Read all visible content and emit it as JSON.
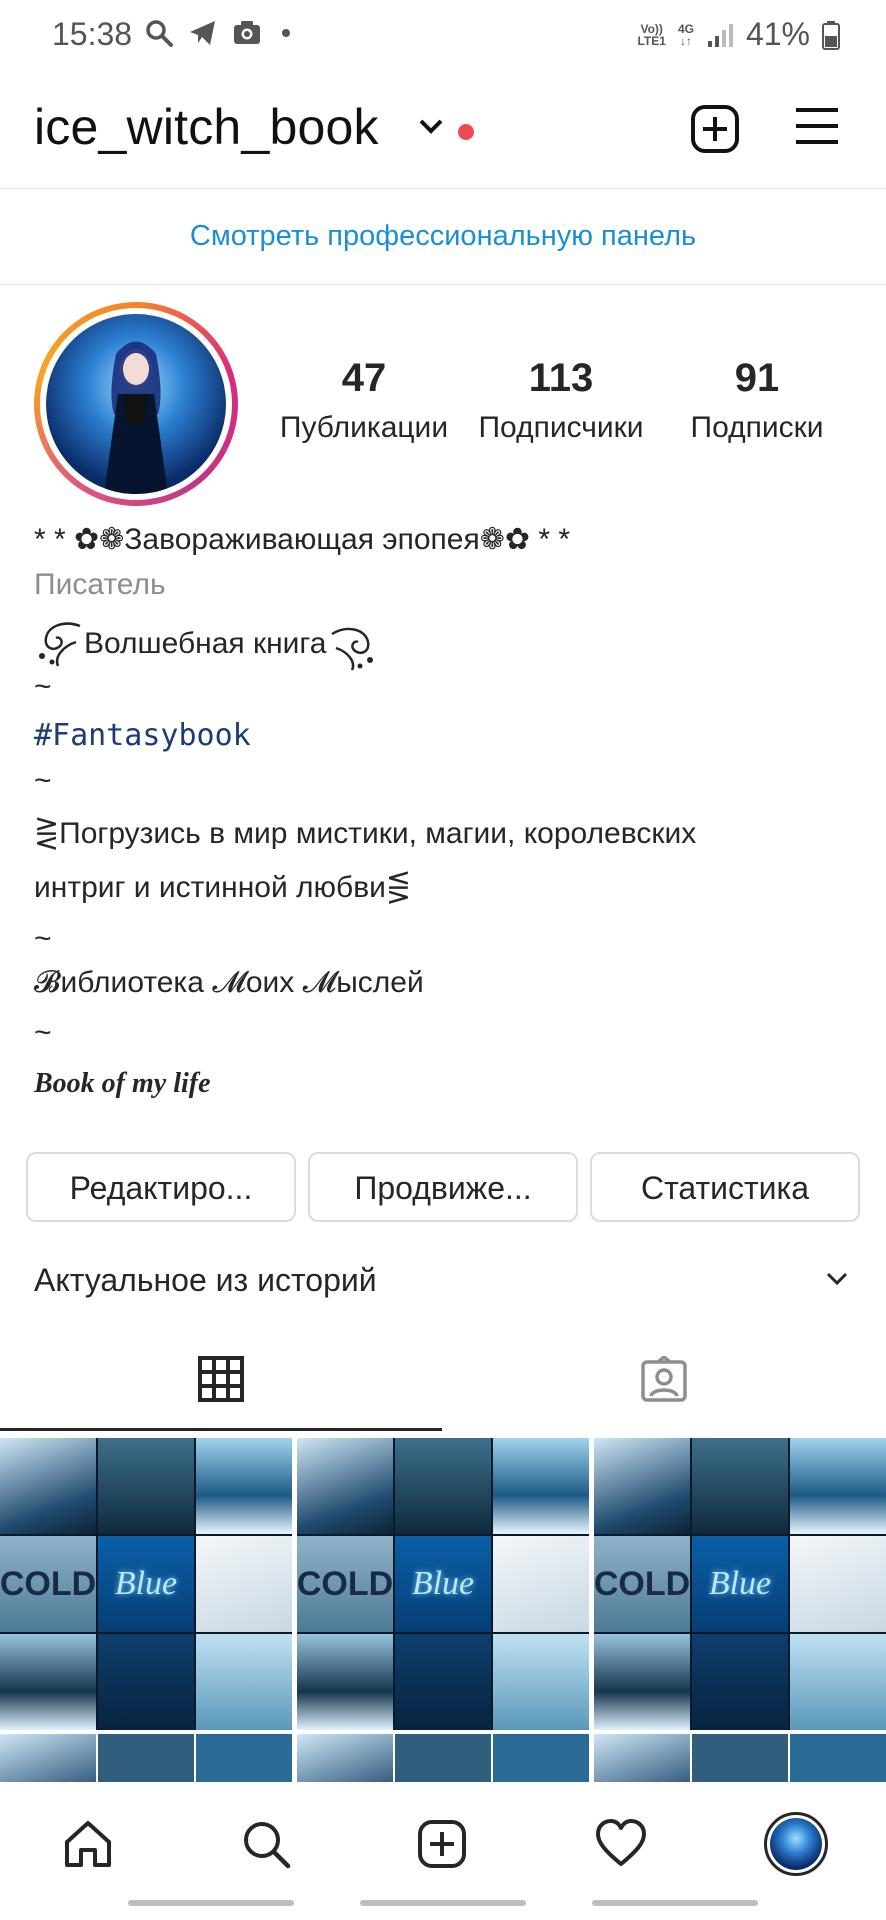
{
  "status_bar": {
    "time": "15:38",
    "network_top": "Vo))",
    "network_bottom": "LTE1",
    "network_type": "4G",
    "battery": "41%"
  },
  "header": {
    "username": "ice_witch_book",
    "icons": [
      "chevron-down-icon",
      "plus-square-icon",
      "menu-icon"
    ]
  },
  "professional_dashboard": "Смотреть профессиональную панель",
  "profile": {
    "stats": [
      {
        "value": "47",
        "label": "Публикации"
      },
      {
        "value": "113",
        "label": "Подписчики"
      },
      {
        "value": "91",
        "label": "Подписки"
      }
    ],
    "bio": {
      "name_line": "* * ✿❁Завораживающая эпопея❁✿ * *",
      "category": "Писатель",
      "line_book": "Волшебная книга",
      "sep1": "~",
      "hashtag": "#Fantasybook",
      "sep2": "~",
      "line_immerse_1": "⋛Погрузись в мир мистики, магии, королевских",
      "line_immerse_2": "интриг и истинной любви⋚",
      "sep3": "~",
      "line_library": "𝓑иблиотека 𝓜оих 𝓜ыслей",
      "sep4": "~",
      "line_book_of_life": "Book of my life"
    }
  },
  "actions": {
    "edit": "Редактиро...",
    "promote": "Продвиже...",
    "insights": "Статистика"
  },
  "highlights": {
    "label": "Актуальное из историй"
  },
  "grid_posts": [
    {
      "word1": "COLD",
      "word2": "Blue"
    },
    {
      "word1": "COLD",
      "word2": "Blue"
    },
    {
      "word1": "COLD",
      "word2": "Blue"
    }
  ],
  "colors": {
    "link_blue": "#1b8fd6",
    "hashtag_blue": "#1a3d79",
    "notification_red": "#ed4956"
  }
}
